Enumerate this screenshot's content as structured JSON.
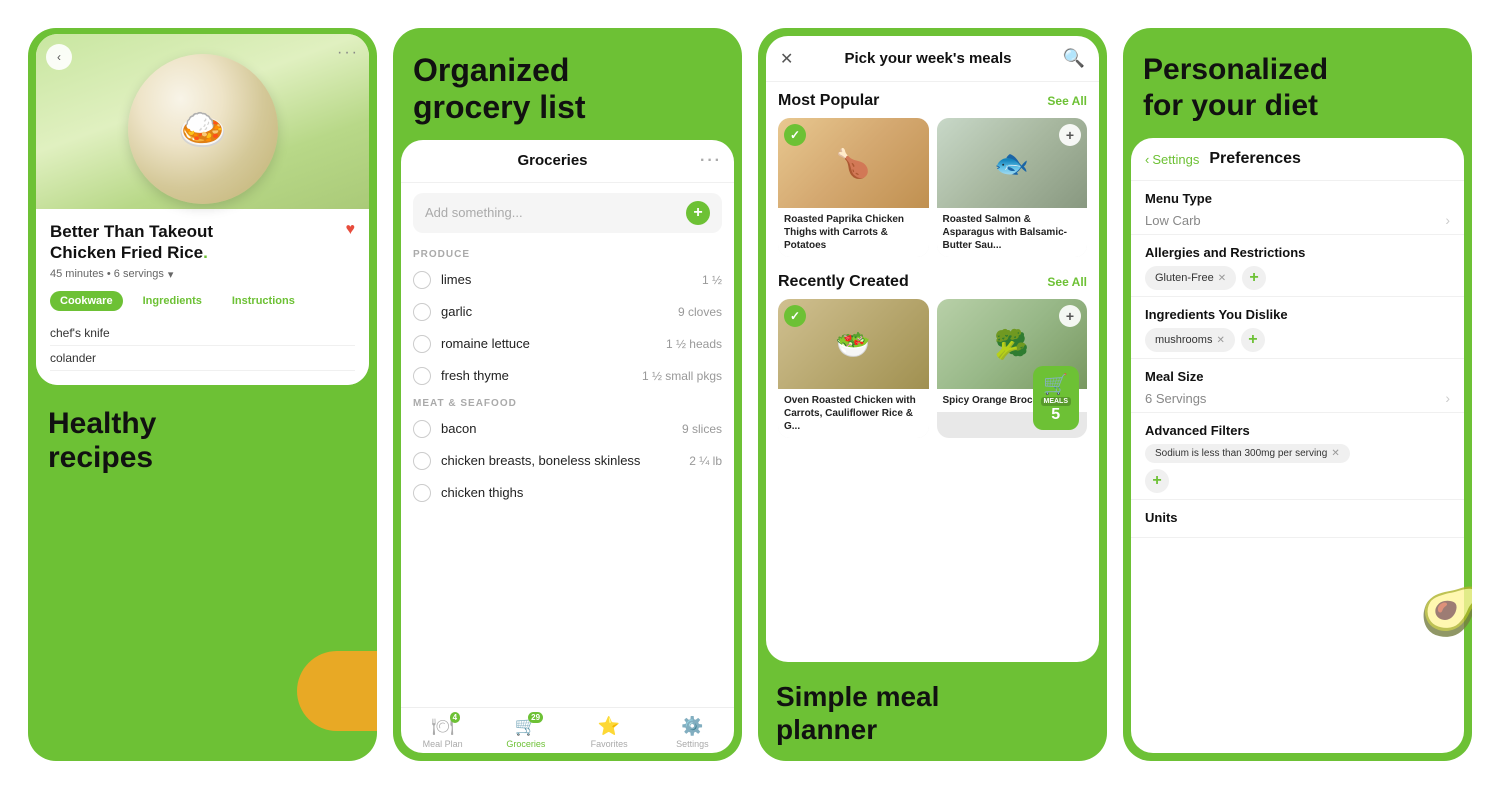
{
  "panel1": {
    "heading": "Healthy\nrecipes",
    "recipe_title": "Better Than Takeout\nChicken Fried Rice",
    "recipe_meta": "45 minutes • 6 servings",
    "tabs": [
      "Cookware",
      "Ingredients",
      "Instructions"
    ],
    "active_tab": "Cookware",
    "items": [
      "chef's knife",
      "colander"
    ],
    "food_emoji": "🍛",
    "back_label": "‹",
    "more_label": "···"
  },
  "panel2": {
    "heading": "Organized\ngrocery list",
    "grocery_title": "Groceries",
    "search_placeholder": "Add something...",
    "sections": [
      {
        "label": "PRODUCE",
        "items": [
          {
            "name": "limes",
            "qty": "1 ½"
          },
          {
            "name": "garlic",
            "qty": "9 cloves"
          },
          {
            "name": "romaine lettuce",
            "qty": "1 ½ heads"
          },
          {
            "name": "fresh thyme",
            "qty": "1 ½ small pkgs"
          }
        ]
      },
      {
        "label": "MEAT & SEAFOOD",
        "items": [
          {
            "name": "bacon",
            "qty": "9 slices"
          },
          {
            "name": "chicken breasts, boneless skinless",
            "qty": "2 ¼ lb"
          },
          {
            "name": "chicken thighs",
            "qty": ""
          }
        ]
      }
    ],
    "nav": [
      {
        "label": "Meal Plan",
        "icon": "🍽",
        "badge": "4",
        "active": false
      },
      {
        "label": "Groceries",
        "icon": "🛒",
        "badge": "29",
        "active": true
      },
      {
        "label": "Favorites",
        "icon": "⭐",
        "badge": "",
        "active": false
      },
      {
        "label": "Settings",
        "icon": "⚙️",
        "badge": "",
        "active": false
      }
    ]
  },
  "panel3": {
    "heading": "Simple meal\nplanner",
    "picker_title": "Pick your week's meals",
    "most_popular_label": "Most Popular",
    "see_all": "See All",
    "recently_created_label": "Recently Created",
    "meals_popular": [
      {
        "name": "Roasted Paprika Chicken Thighs with Carrots & Potatoes",
        "checked": true
      },
      {
        "name": "Roasted Salmon & Asparagus with Balsamic-Butter Sau...",
        "checked": false
      }
    ],
    "meals_recent": [
      {
        "name": "Oven Roasted Chicken with Carrots, Cauliflower Rice & G...",
        "checked": true
      },
      {
        "name": "Spicy Orange Broccoli...",
        "checked": false
      }
    ],
    "cart_label": "MEALS",
    "cart_count": "5"
  },
  "panel4": {
    "heading": "Personalized\nfor your diet",
    "settings_back": "Settings",
    "preferences_tab": "Preferences",
    "menu_type_label": "Menu Type",
    "menu_type_value": "Low Carb",
    "allergies_label": "Allergies and Restrictions",
    "allergies_tags": [
      "Gluten-Free"
    ],
    "dislike_label": "Ingredients You Dislike",
    "dislike_tags": [
      "mushrooms"
    ],
    "meal_size_label": "Meal Size",
    "meal_size_value": "6 Servings",
    "advanced_label": "Advanced Filters",
    "advanced_filter": "Sodium is less than 300mg per serving",
    "units_label": "Units"
  }
}
